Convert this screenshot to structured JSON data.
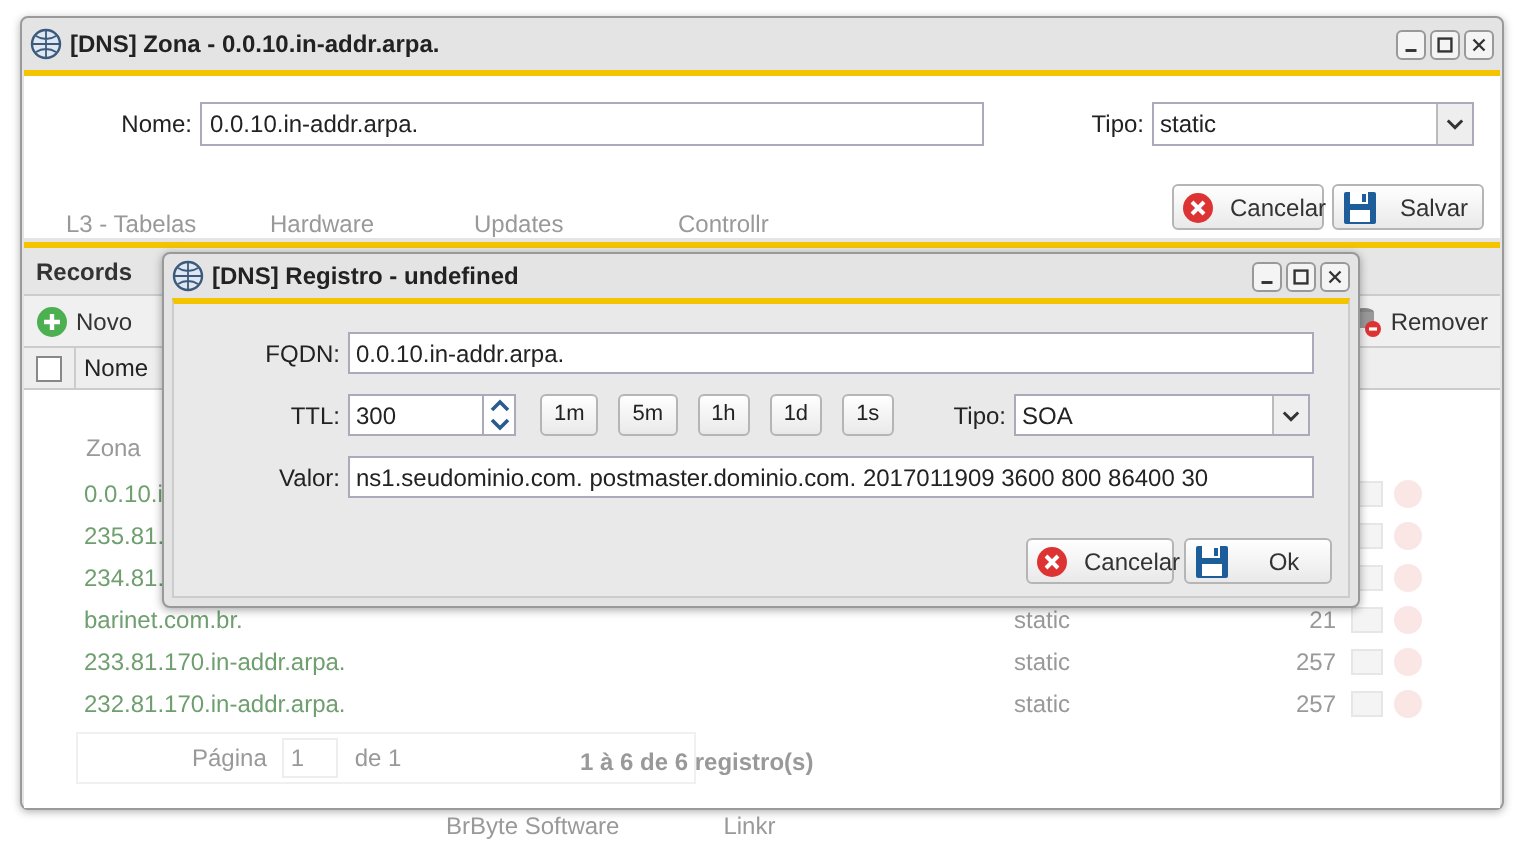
{
  "zone_window": {
    "title": "[DNS] Zona - 0.0.10.in-addr.arpa.",
    "nome_label": "Nome:",
    "nome_value": "0.0.10.in-addr.arpa.",
    "tipo_label": "Tipo:",
    "tipo_value": "static",
    "buttons": [
      {
        "label": "Cancelar",
        "kind": "cancel"
      },
      {
        "label": "Salvar",
        "kind": "save"
      }
    ]
  },
  "records": {
    "title": "Records",
    "toolbar": [
      {
        "label": "Novo",
        "kind": "add"
      },
      {
        "label": "Remover",
        "kind": "remove"
      }
    ],
    "columns": [
      "Nome"
    ],
    "select_all_checked": false
  },
  "record_dialog": {
    "title": "[DNS] Registro - undefined",
    "fqdn_label": "FQDN:",
    "fqdn_value": "0.0.10.in-addr.arpa.",
    "ttl_label": "TTL:",
    "ttl_value": "300",
    "ttl_presets": [
      "1m",
      "5m",
      "1h",
      "1d",
      "1s"
    ],
    "tipo_label": "Tipo:",
    "tipo_value": "SOA",
    "valor_label": "Valor:",
    "valor_value": "ns1.seudominio.com. postmaster.dominio.com. 2017011909 3600 800 86400 30",
    "buttons": [
      {
        "label": "Cancelar",
        "kind": "cancel"
      },
      {
        "label": "Ok",
        "kind": "save"
      }
    ]
  },
  "background": {
    "desktop_labels_bottom": [
      "L3 - Tabelas",
      "Hardware",
      "Updates",
      "Controllr"
    ],
    "grid_header": "Zona",
    "grid_rows": [
      {
        "name": "0.0.10.i"
      },
      {
        "name": "235.81."
      },
      {
        "name": "234.81."
      },
      {
        "name": "barinet.com.br.",
        "type": "static",
        "count": "21"
      },
      {
        "name": "233.81.170.in-addr.arpa.",
        "type": "static",
        "count": "257"
      },
      {
        "name": "232.81.170.in-addr.arpa.",
        "type": "static",
        "count": "257"
      }
    ],
    "pagination": {
      "page_label": "Página",
      "page_value": "1",
      "of": "de 1",
      "summary": "1 à 6 de 6 registro(s)"
    },
    "footer": [
      "BrByte Software",
      "Linkr"
    ]
  }
}
